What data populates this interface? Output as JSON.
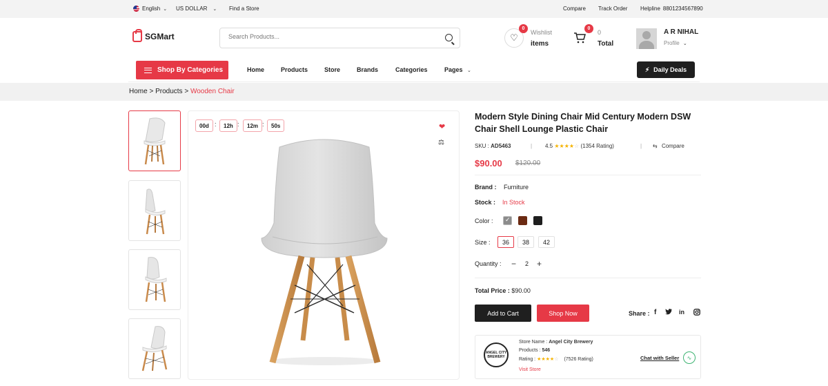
{
  "topbar": {
    "language": "English",
    "currency": "US DOLLAR",
    "find_store": "Find a Store",
    "compare": "Compare",
    "track_order": "Track Order",
    "helpline_label": "Helpline",
    "helpline_number": "8801234567890"
  },
  "header": {
    "logo": "SGMart",
    "search_placeholder": "Search Products...",
    "wishlist_count": "0",
    "wishlist_label": "Wishlist",
    "wishlist_value": "items",
    "cart_count": "0",
    "cart_label": "0",
    "cart_value": "Total",
    "user_name": "A R NIHAL",
    "profile_label": "Profile"
  },
  "nav": {
    "category_button": "Shop By Categories",
    "items": [
      "Home",
      "Products",
      "Store",
      "Brands",
      "Categories",
      "Pages"
    ],
    "daily_deals": "Daily Deals"
  },
  "breadcrumb": {
    "home": "Home",
    "sep": ">",
    "products": "Products",
    "current": "Wooden Chair"
  },
  "timer": {
    "days": "00d",
    "hours": "12h",
    "minutes": "12m",
    "seconds": "50s"
  },
  "product": {
    "title": "Modern Style Dining Chair Mid Century Modern DSW Chair Shell Lounge Plastic Chair",
    "sku_label": "SKU :",
    "sku": "AD5463",
    "rating": "4.5",
    "rating_value": 4.5,
    "rating_count": "(1354 Rating)",
    "compare": "Compare",
    "price": "$90.00",
    "old_price": "$120.00",
    "brand_label": "Brand :",
    "brand": "Furniture",
    "stock_label": "Stock :",
    "stock": "In Stock",
    "color_label": "Color :",
    "colors": [
      "#8c8c8c",
      "#6b2a12",
      "#1e1e1e"
    ],
    "size_label": "Size :",
    "sizes": [
      "36",
      "38",
      "42"
    ],
    "selected_size": "36",
    "quantity_label": "Quantity :",
    "quantity": "2",
    "total_label": "Total Price :",
    "total": "$90.00",
    "add_to_cart": "Add to Cart",
    "shop_now": "Shop Now",
    "share_label": "Share :"
  },
  "store": {
    "name_label": "Store Name :",
    "name": "Angel City Brewery",
    "products_label": "Products :",
    "products": "546",
    "rating_label": "Rating :",
    "rating_value": 4,
    "rating_count": "(7526 Rating)",
    "visit": "Visit Store",
    "chat": "Chat with Seller",
    "logo_text": "ANGEL CITY BREWERY"
  },
  "colors": {
    "accent": "#e63946",
    "dark": "#1f1f1f"
  }
}
